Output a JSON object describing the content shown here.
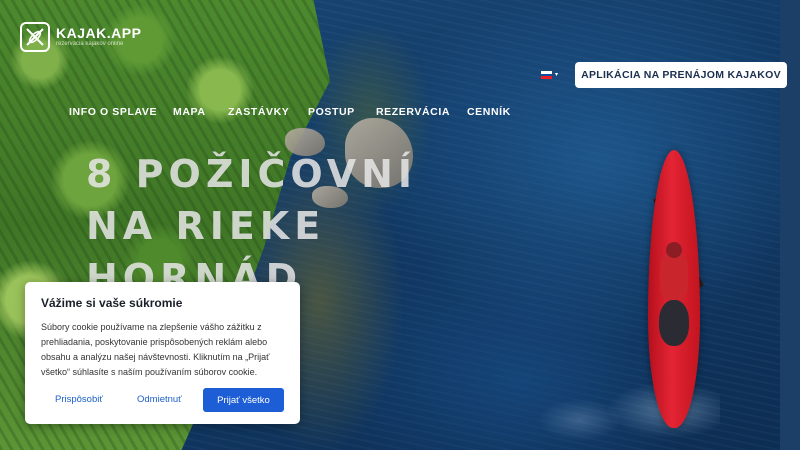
{
  "brand": {
    "logo_icon": "kayak-paddles-icon",
    "title": "KAJAK.APP",
    "subtitle": "rezervácia kajakov online"
  },
  "language": {
    "selected": "Slovenčina",
    "flag_colors": [
      "#ffffff",
      "#0b4ea2",
      "#ee1c25"
    ]
  },
  "header": {
    "cta_label": "APLIKÁCIA NA PRENÁJOM KAJAKOV"
  },
  "nav": {
    "items": [
      {
        "label": "INFO O SPLAVE"
      },
      {
        "label": "MAPA"
      },
      {
        "label": "ZASTÁVKY"
      },
      {
        "label": "POSTUP"
      },
      {
        "label": "REZERVÁCIA"
      },
      {
        "label": "CENNÍK"
      }
    ]
  },
  "hero": {
    "headline_lines": [
      "8 POŽIČOVNÍ",
      "NA RIEKE",
      "HORNÁD"
    ]
  },
  "cookie": {
    "title": "Vážime si vaše súkromie",
    "text": "Súbory cookie používame na zlepšenie vášho zážitku z prehliadania, poskytovanie prispôsobených reklám alebo obsahu a analýzu našej návštevnosti. Kliknutím na „Prijať všetko“ súhlasíte s naším používaním súborov cookie.",
    "customize_label": "Prispôsobiť",
    "reject_label": "Odmietnuť",
    "accept_label": "Prijať všetko",
    "accent_color": "#1d5ed6"
  }
}
